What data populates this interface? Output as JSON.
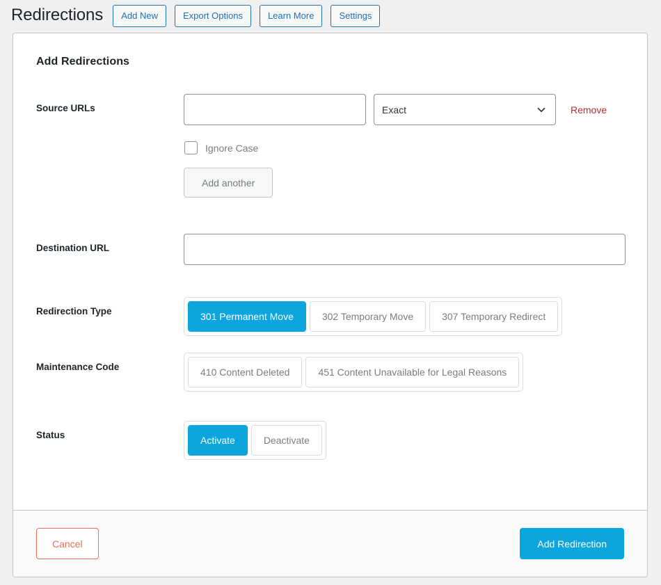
{
  "header": {
    "title": "Redirections",
    "buttons": [
      {
        "label": "Add New"
      },
      {
        "label": "Export Options"
      },
      {
        "label": "Learn More"
      },
      {
        "label": "Settings"
      }
    ]
  },
  "card": {
    "heading": "Add Redirections",
    "source": {
      "label": "Source URLs",
      "url_value": "",
      "url_placeholder": "",
      "match_type_selected": "Exact",
      "match_type_icon": "chevron-down-icon",
      "remove_label": "Remove",
      "ignore_case_label": "Ignore Case",
      "ignore_case_checked": false,
      "add_another_label": "Add another"
    },
    "destination": {
      "label": "Destination URL",
      "url_value": "",
      "url_placeholder": ""
    },
    "redirection_type": {
      "label": "Redirection Type",
      "options": [
        {
          "label": "301 Permanent Move",
          "active": true
        },
        {
          "label": "302 Temporary Move",
          "active": false
        },
        {
          "label": "307 Temporary Redirect",
          "active": false
        }
      ]
    },
    "maintenance_code": {
      "label": "Maintenance Code",
      "options": [
        {
          "label": "410 Content Deleted",
          "active": false
        },
        {
          "label": "451 Content Unavailable for Legal Reasons",
          "active": false
        }
      ]
    },
    "status": {
      "label": "Status",
      "options": [
        {
          "label": "Activate",
          "active": true
        },
        {
          "label": "Deactivate",
          "active": false
        }
      ]
    },
    "footer": {
      "cancel_label": "Cancel",
      "submit_label": "Add Redirection"
    }
  },
  "colors": {
    "accent_blue": "#0ca5dd",
    "link_blue": "#2271b1",
    "danger_red": "#b32d2e",
    "cancel_red": "#e8705c",
    "page_bg": "#f0f0f1"
  }
}
